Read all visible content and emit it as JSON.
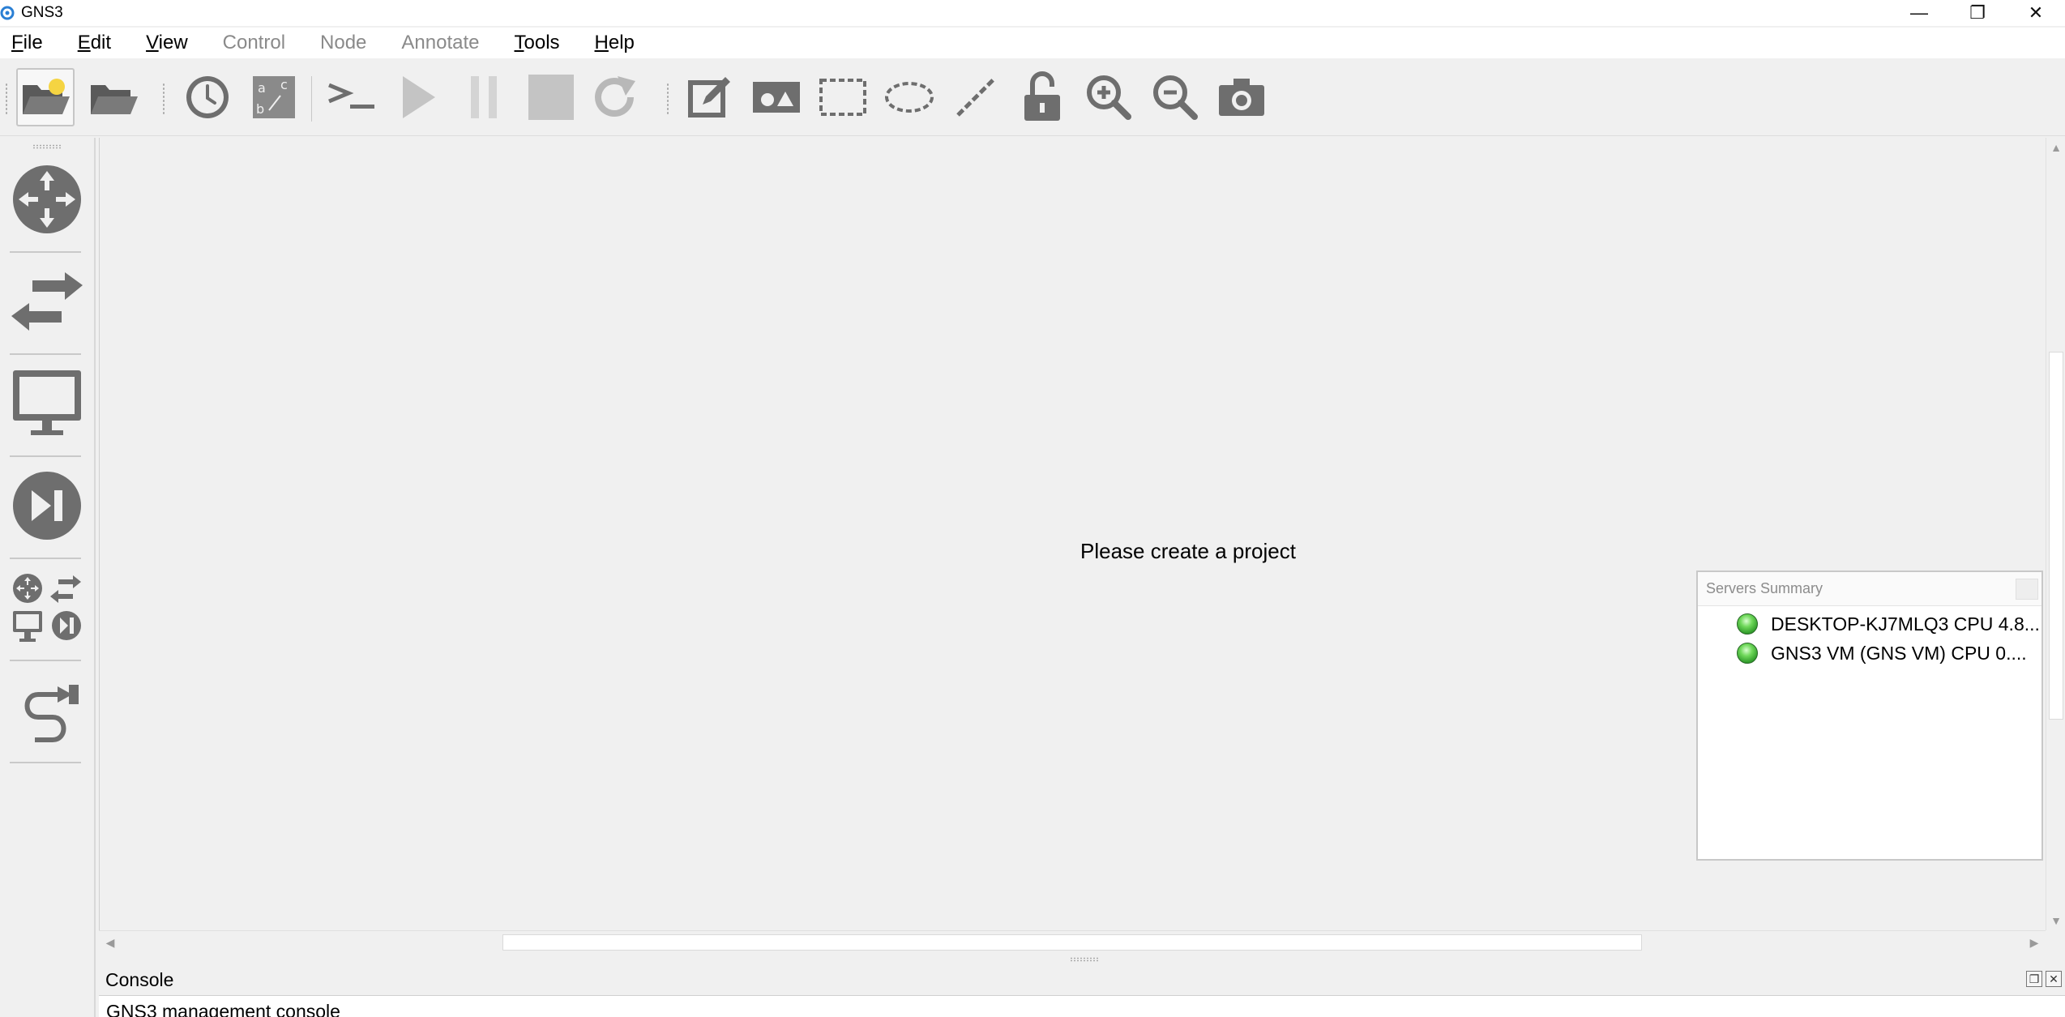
{
  "window": {
    "title": "GNS3",
    "controls": {
      "minimize": "—",
      "restore": "❐",
      "close": "✕"
    }
  },
  "menu": [
    {
      "accel": "F",
      "rest": "ile",
      "enabled": true
    },
    {
      "accel": "E",
      "rest": "dit",
      "enabled": true
    },
    {
      "accel": "V",
      "rest": "iew",
      "enabled": true
    },
    {
      "accel": "",
      "rest": "Control",
      "enabled": false
    },
    {
      "accel": "",
      "rest": "Node",
      "enabled": false
    },
    {
      "accel": "",
      "rest": "Annotate",
      "enabled": false
    },
    {
      "accel": "T",
      "rest": "ools",
      "enabled": true
    },
    {
      "accel": "H",
      "rest": "elp",
      "enabled": true
    }
  ],
  "toolbar": {
    "icons": [
      "new-project-icon",
      "open-project-icon",
      "snapshot-clock-icon",
      "interface-labels-icon",
      "console-all-icon",
      "start-all-icon",
      "suspend-all-icon",
      "stop-all-icon",
      "reload-all-icon",
      "add-note-icon",
      "insert-picture-icon",
      "draw-rectangle-icon",
      "draw-ellipse-icon",
      "draw-line-icon",
      "lock-unlock-icon",
      "zoom-in-icon",
      "zoom-out-icon",
      "screenshot-icon"
    ]
  },
  "dock": {
    "icons": [
      "routers-icon",
      "switches-icon",
      "end-devices-icon",
      "security-devices-icon",
      "all-devices-icon",
      "add-link-icon"
    ]
  },
  "canvas": {
    "message": "Please create a project"
  },
  "servers_summary": {
    "title": "Servers Summary",
    "servers": [
      {
        "label": "DESKTOP-KJ7MLQ3 CPU 4.8...",
        "status": "running"
      },
      {
        "label": "GNS3 VM (GNS VM) CPU 0....",
        "status": "running"
      }
    ]
  },
  "console": {
    "title": "Console",
    "text": "GNS3 management console"
  },
  "colors": {
    "icon_gray": "#6e6e6e",
    "icon_disabled": "#c4c4c4",
    "status_green": "#4cc03a",
    "folder_yellow": "#f5d442"
  }
}
